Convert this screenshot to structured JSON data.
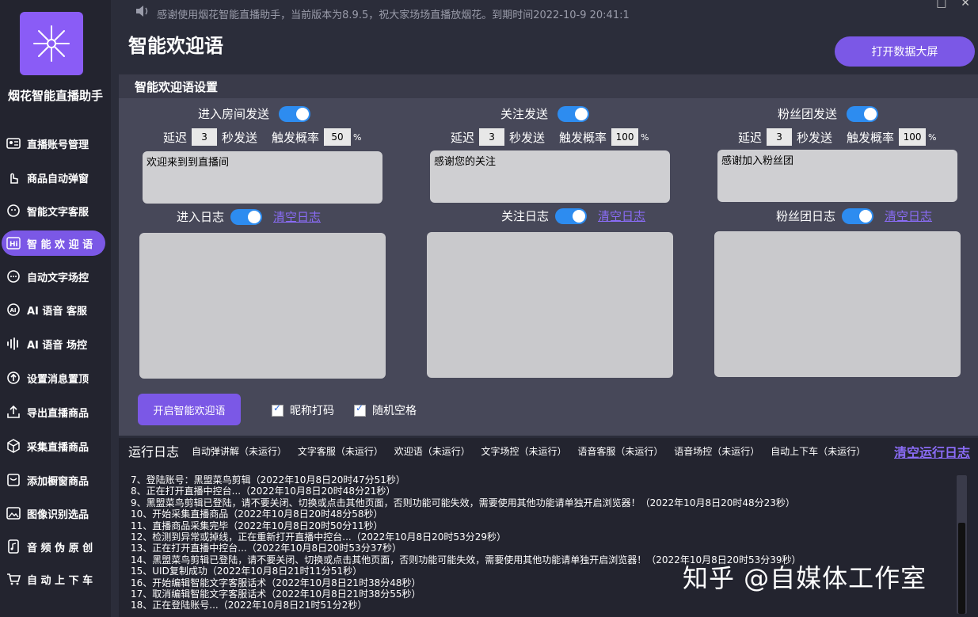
{
  "app": {
    "name": "烟花智能直播助手",
    "notice": "感谢使用烟花智能直播助手，当前版本为8.9.5，祝大家场场直播放烟花。到期时间2022-10-9 20:41:1",
    "accent": "#7b58e6"
  },
  "sidebar": {
    "items": [
      {
        "label": "直播账号管理",
        "icon": "id-card-icon"
      },
      {
        "label": "商品自动弹窗",
        "icon": "tap-hand-icon"
      },
      {
        "label": "智能文字客服",
        "icon": "support-face-icon"
      },
      {
        "label": "智 能 欢 迎 语",
        "icon": "hi-icon",
        "active": true
      },
      {
        "label": "自动文字场控",
        "icon": "chat-bubble-icon"
      },
      {
        "label": "AI 语音 客服",
        "icon": "ai-bubble-icon"
      },
      {
        "label": "AI 语音 场控",
        "icon": "sound-wave-icon"
      },
      {
        "label": "设置消息置顶",
        "icon": "arrow-up-circle-icon"
      },
      {
        "label": "导出直播商品",
        "icon": "upload-icon"
      },
      {
        "label": "采集直播商品",
        "icon": "box-icon"
      },
      {
        "label": "添加橱窗商品",
        "icon": "shop-icon"
      },
      {
        "label": "图像识别选品",
        "icon": "image-icon"
      },
      {
        "label": "音 频 伪 原 创",
        "icon": "music-file-icon"
      },
      {
        "label": "自 动 上 下 车",
        "icon": "cart-icon"
      }
    ]
  },
  "main": {
    "title": "智能欢迎语",
    "open_bigscreen": "打开数据大屏",
    "settings_title": "智能欢迎语设置",
    "delay_prefix": "延迟",
    "delay_suffix": "秒发送",
    "prob_label": "触发概率",
    "percent": "%",
    "clear_log": "清空日志",
    "columns": [
      {
        "send_label": "进入房间发送",
        "delay": "3",
        "prob": "50",
        "message": "欢迎来到到直播间",
        "log_label": "进入日志"
      },
      {
        "send_label": "关注发送",
        "delay": "3",
        "prob": "100",
        "message": "感谢您的关注",
        "log_label": "关注日志"
      },
      {
        "send_label": "粉丝团发送",
        "delay": "3",
        "prob": "100",
        "message": "感谢加入粉丝团",
        "log_label": "粉丝团日志"
      }
    ],
    "start_button": "开启智能欢迎语",
    "checkbox_nick": "昵称打码",
    "checkbox_space": "随机空格"
  },
  "runlog": {
    "title": "运行日志",
    "statuses": [
      "自动弹讲解（未运行）",
      "文字客服（未运行）",
      "欢迎语（未运行）",
      "文字场控（未运行）",
      "语音客服（未运行）",
      "语音场控（未运行）",
      "自动上下车（未运行）"
    ],
    "clear": "清空运行日志",
    "lines": [
      "7、登陆账号：黑盟菜鸟剪辑（2022年10月8日20时47分51秒）",
      "8、正在打开直播中控台...（2022年10月8日20时48分21秒）",
      "9、黑盟菜鸟剪辑已登陆，请不要关闭、切换或点击其他页面，否则功能可能失效，需要使用其他功能请单独开启浏览器！（2022年10月8日20时48分23秒）",
      "10、开始采集直播商品（2022年10月8日20时48分58秒）",
      "11、直播商品采集完毕（2022年10月8日20时50分11秒）",
      "12、检测到异常或掉线，正在重新打开直播中控台...（2022年10月8日20时53分29秒）",
      "13、正在打开直播中控台...（2022年10月8日20时53分37秒）",
      "14、黑盟菜鸟剪辑已登陆，请不要关闭、切换或点击其他页面，否则功能可能失效，需要使用其他功能请单独开启浏览器！（2022年10月8日20时53分39秒）",
      "15、UID复制成功（2022年10月8日21时11分51秒）",
      "16、开始编辑智能文字客服话术（2022年10月8日21时38分48秒）",
      "17、取消编辑智能文字客服话术（2022年10月8日21时38分55秒）",
      "18、正在登陆账号...（2022年10月8日21时51分2秒）"
    ]
  },
  "watermark": "知乎 @自媒体工作室"
}
